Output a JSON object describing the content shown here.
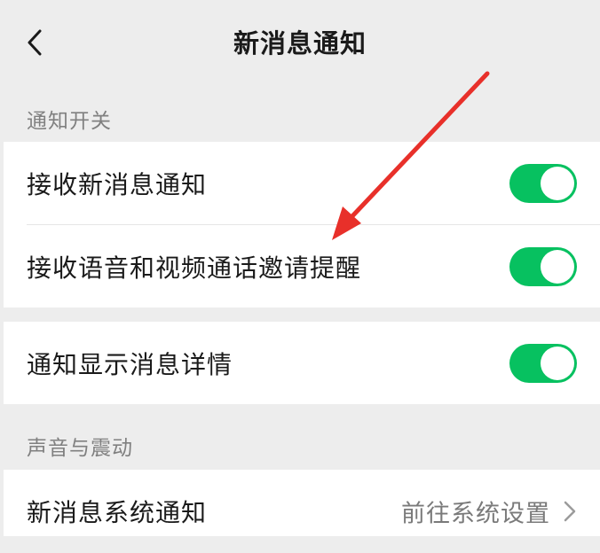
{
  "header": {
    "title": "新消息通知"
  },
  "sections": {
    "notify_switch_label": "通知开关",
    "sound_label": "声音与震动"
  },
  "rows": {
    "receive_new": {
      "label": "接收新消息通知",
      "on": true
    },
    "voice_video": {
      "label": "接收语音和视频通话邀请提醒",
      "on": true
    },
    "show_details": {
      "label": "通知显示消息详情",
      "on": true
    },
    "system_notify": {
      "label": "新消息系统通知",
      "value": "前往系统设置"
    }
  },
  "colors": {
    "toggle_on": "#07c160",
    "background": "#ededed",
    "annotation_arrow": "#e8302a"
  },
  "icons": {
    "back": "chevron-left-icon",
    "row_arrow": "chevron-right-icon"
  }
}
